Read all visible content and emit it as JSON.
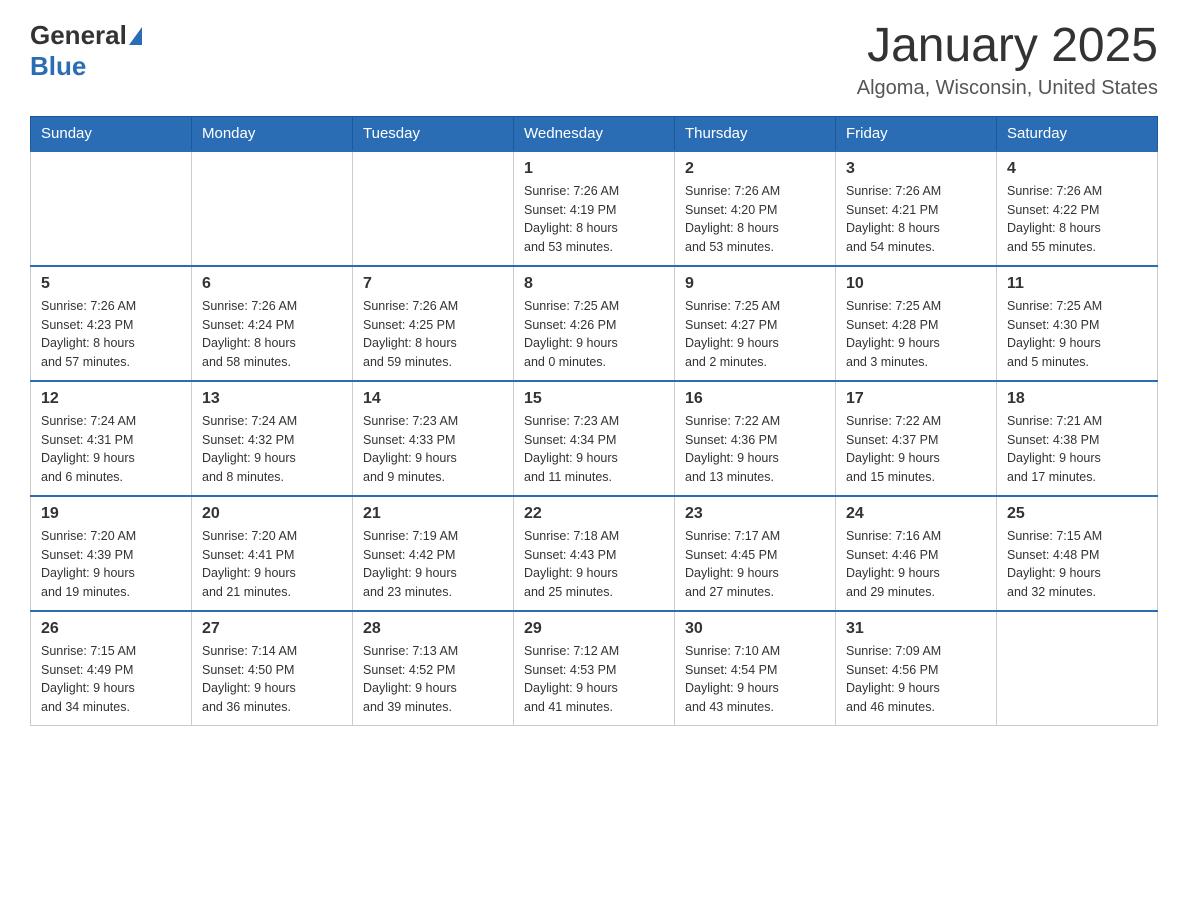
{
  "logo": {
    "text_general": "General",
    "text_blue": "Blue",
    "triangle": "▶"
  },
  "title": "January 2025",
  "location": "Algoma, Wisconsin, United States",
  "days_of_week": [
    "Sunday",
    "Monday",
    "Tuesday",
    "Wednesday",
    "Thursday",
    "Friday",
    "Saturday"
  ],
  "weeks": [
    [
      {
        "day": "",
        "info": ""
      },
      {
        "day": "",
        "info": ""
      },
      {
        "day": "",
        "info": ""
      },
      {
        "day": "1",
        "info": "Sunrise: 7:26 AM\nSunset: 4:19 PM\nDaylight: 8 hours\nand 53 minutes."
      },
      {
        "day": "2",
        "info": "Sunrise: 7:26 AM\nSunset: 4:20 PM\nDaylight: 8 hours\nand 53 minutes."
      },
      {
        "day": "3",
        "info": "Sunrise: 7:26 AM\nSunset: 4:21 PM\nDaylight: 8 hours\nand 54 minutes."
      },
      {
        "day": "4",
        "info": "Sunrise: 7:26 AM\nSunset: 4:22 PM\nDaylight: 8 hours\nand 55 minutes."
      }
    ],
    [
      {
        "day": "5",
        "info": "Sunrise: 7:26 AM\nSunset: 4:23 PM\nDaylight: 8 hours\nand 57 minutes."
      },
      {
        "day": "6",
        "info": "Sunrise: 7:26 AM\nSunset: 4:24 PM\nDaylight: 8 hours\nand 58 minutes."
      },
      {
        "day": "7",
        "info": "Sunrise: 7:26 AM\nSunset: 4:25 PM\nDaylight: 8 hours\nand 59 minutes."
      },
      {
        "day": "8",
        "info": "Sunrise: 7:25 AM\nSunset: 4:26 PM\nDaylight: 9 hours\nand 0 minutes."
      },
      {
        "day": "9",
        "info": "Sunrise: 7:25 AM\nSunset: 4:27 PM\nDaylight: 9 hours\nand 2 minutes."
      },
      {
        "day": "10",
        "info": "Sunrise: 7:25 AM\nSunset: 4:28 PM\nDaylight: 9 hours\nand 3 minutes."
      },
      {
        "day": "11",
        "info": "Sunrise: 7:25 AM\nSunset: 4:30 PM\nDaylight: 9 hours\nand 5 minutes."
      }
    ],
    [
      {
        "day": "12",
        "info": "Sunrise: 7:24 AM\nSunset: 4:31 PM\nDaylight: 9 hours\nand 6 minutes."
      },
      {
        "day": "13",
        "info": "Sunrise: 7:24 AM\nSunset: 4:32 PM\nDaylight: 9 hours\nand 8 minutes."
      },
      {
        "day": "14",
        "info": "Sunrise: 7:23 AM\nSunset: 4:33 PM\nDaylight: 9 hours\nand 9 minutes."
      },
      {
        "day": "15",
        "info": "Sunrise: 7:23 AM\nSunset: 4:34 PM\nDaylight: 9 hours\nand 11 minutes."
      },
      {
        "day": "16",
        "info": "Sunrise: 7:22 AM\nSunset: 4:36 PM\nDaylight: 9 hours\nand 13 minutes."
      },
      {
        "day": "17",
        "info": "Sunrise: 7:22 AM\nSunset: 4:37 PM\nDaylight: 9 hours\nand 15 minutes."
      },
      {
        "day": "18",
        "info": "Sunrise: 7:21 AM\nSunset: 4:38 PM\nDaylight: 9 hours\nand 17 minutes."
      }
    ],
    [
      {
        "day": "19",
        "info": "Sunrise: 7:20 AM\nSunset: 4:39 PM\nDaylight: 9 hours\nand 19 minutes."
      },
      {
        "day": "20",
        "info": "Sunrise: 7:20 AM\nSunset: 4:41 PM\nDaylight: 9 hours\nand 21 minutes."
      },
      {
        "day": "21",
        "info": "Sunrise: 7:19 AM\nSunset: 4:42 PM\nDaylight: 9 hours\nand 23 minutes."
      },
      {
        "day": "22",
        "info": "Sunrise: 7:18 AM\nSunset: 4:43 PM\nDaylight: 9 hours\nand 25 minutes."
      },
      {
        "day": "23",
        "info": "Sunrise: 7:17 AM\nSunset: 4:45 PM\nDaylight: 9 hours\nand 27 minutes."
      },
      {
        "day": "24",
        "info": "Sunrise: 7:16 AM\nSunset: 4:46 PM\nDaylight: 9 hours\nand 29 minutes."
      },
      {
        "day": "25",
        "info": "Sunrise: 7:15 AM\nSunset: 4:48 PM\nDaylight: 9 hours\nand 32 minutes."
      }
    ],
    [
      {
        "day": "26",
        "info": "Sunrise: 7:15 AM\nSunset: 4:49 PM\nDaylight: 9 hours\nand 34 minutes."
      },
      {
        "day": "27",
        "info": "Sunrise: 7:14 AM\nSunset: 4:50 PM\nDaylight: 9 hours\nand 36 minutes."
      },
      {
        "day": "28",
        "info": "Sunrise: 7:13 AM\nSunset: 4:52 PM\nDaylight: 9 hours\nand 39 minutes."
      },
      {
        "day": "29",
        "info": "Sunrise: 7:12 AM\nSunset: 4:53 PM\nDaylight: 9 hours\nand 41 minutes."
      },
      {
        "day": "30",
        "info": "Sunrise: 7:10 AM\nSunset: 4:54 PM\nDaylight: 9 hours\nand 43 minutes."
      },
      {
        "day": "31",
        "info": "Sunrise: 7:09 AM\nSunset: 4:56 PM\nDaylight: 9 hours\nand 46 minutes."
      },
      {
        "day": "",
        "info": ""
      }
    ]
  ]
}
